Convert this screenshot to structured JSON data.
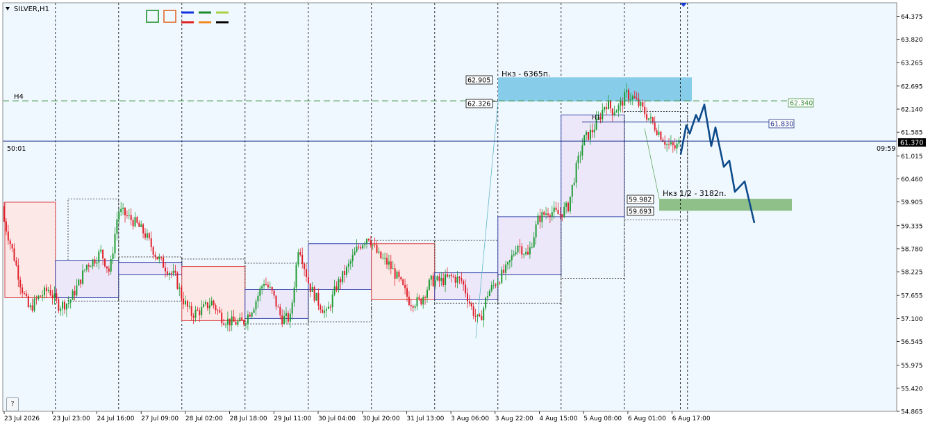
{
  "window": {
    "symbol_title": "SILVER,H1",
    "menu_arrow": "triangle-down-icon",
    "help_label": "?"
  },
  "colors": {
    "background": "#f0f8ff",
    "frame": "#8a8a8a",
    "grid_vertical": "#000000",
    "bull_candle": "#1e9b32",
    "bear_candle": "#e0202a",
    "forecast_line": "#0d4a8a",
    "bid_line": "#1c2f8a",
    "resistance_zone": "#87cdea",
    "support_zone": "#8fc08a",
    "h4_level": "#3d8f3d",
    "red_box_fill": "#fde8e8",
    "red_box_border": "#d93030",
    "blue_box_fill": "#ece8fa",
    "blue_box_border": "#2030a0"
  },
  "toolbar_swatches": [
    {
      "name": "green-square-icon",
      "color": "#1f8f2f"
    },
    {
      "name": "orange-square-icon",
      "color": "#e06a2a"
    },
    {
      "name": "blue-line-icon",
      "color": "#1030e0"
    },
    {
      "name": "green-line-icon",
      "color": "#1a8a2a"
    },
    {
      "name": "lime-line-icon",
      "color": "#a8d040"
    },
    {
      "name": "red-line-icon",
      "color": "#e02020"
    },
    {
      "name": "orange-line-icon",
      "color": "#f08a20"
    },
    {
      "name": "black-line-icon",
      "color": "#000000"
    }
  ],
  "labels": {
    "h4": "H4",
    "h1": "H1",
    "resistance_note": "Нкз - 6365п.",
    "support_note": "Нкз 1/2 - 3182п.",
    "left_timer": "50:01",
    "right_timer": "09:59",
    "resistance_top": "62.905",
    "resistance_bottom": "62.326",
    "support_top": "59.982",
    "support_bottom": "59.693",
    "h4_price": "62.340",
    "line_price": "61.830",
    "current_price": "61.370"
  },
  "chart_data": {
    "type": "candlestick",
    "symbol": "SILVER",
    "timeframe": "H1",
    "ylim": [
      54.865,
      64.7
    ],
    "y_ticks": [
      "64.375",
      "63.820",
      "63.265",
      "62.695",
      "62.140",
      "61.585",
      "61.015",
      "60.460",
      "59.905",
      "59.335",
      "58.780",
      "58.225",
      "57.655",
      "57.100",
      "56.545",
      "55.975",
      "55.420",
      "54.865"
    ],
    "x_ticks": [
      "23 Jul 2026",
      "23 Jul 23:00",
      "24 Jul 16:00",
      "27 Jul 09:00",
      "28 Jul 02:00",
      "28 Jul 18:00",
      "29 Jul 11:00",
      "30 Jul 04:00",
      "30 Jul 20:00",
      "31 Jul 13:00",
      "3 Aug 06:00",
      "3 Aug 22:00",
      "4 Aug 15:00",
      "5 Aug 08:00",
      "6 Aug 01:00",
      "6 Aug 17:00"
    ],
    "price_path": [
      [
        0,
        59.8
      ],
      [
        10,
        59.2
      ],
      [
        20,
        58.6
      ],
      [
        30,
        57.9
      ],
      [
        42,
        57.3
      ],
      [
        55,
        57.6
      ],
      [
        70,
        57.8
      ],
      [
        85,
        57.4
      ],
      [
        100,
        57.5
      ],
      [
        115,
        58.0
      ],
      [
        125,
        58.4
      ],
      [
        135,
        58.5
      ],
      [
        145,
        58.7
      ],
      [
        158,
        58.2
      ],
      [
        170,
        59.7
      ],
      [
        180,
        59.6
      ],
      [
        195,
        59.4
      ],
      [
        210,
        59.1
      ],
      [
        225,
        58.6
      ],
      [
        240,
        58.3
      ],
      [
        252,
        58.1
      ],
      [
        262,
        57.6
      ],
      [
        275,
        57.2
      ],
      [
        290,
        57.3
      ],
      [
        305,
        57.5
      ],
      [
        320,
        57.1
      ],
      [
        335,
        57.0
      ],
      [
        350,
        57.0
      ],
      [
        365,
        57.4
      ],
      [
        380,
        58.0
      ],
      [
        392,
        57.7
      ],
      [
        405,
        57.1
      ],
      [
        418,
        57.1
      ],
      [
        430,
        58.9
      ],
      [
        445,
        57.9
      ],
      [
        458,
        57.5
      ],
      [
        470,
        57.2
      ],
      [
        485,
        57.9
      ],
      [
        500,
        58.3
      ],
      [
        515,
        58.8
      ],
      [
        530,
        59.1
      ],
      [
        545,
        58.6
      ],
      [
        560,
        58.4
      ],
      [
        575,
        58.0
      ],
      [
        590,
        57.5
      ],
      [
        605,
        57.5
      ],
      [
        620,
        58.0
      ],
      [
        635,
        58.0
      ],
      [
        650,
        58.1
      ],
      [
        665,
        58.0
      ],
      [
        680,
        57.3
      ],
      [
        690,
        57.0
      ],
      [
        702,
        57.7
      ],
      [
        715,
        58.0
      ],
      [
        730,
        58.3
      ],
      [
        745,
        58.9
      ],
      [
        760,
        58.6
      ],
      [
        775,
        59.5
      ],
      [
        790,
        59.7
      ],
      [
        805,
        59.6
      ],
      [
        818,
        59.8
      ],
      [
        828,
        60.6
      ],
      [
        840,
        61.4
      ],
      [
        852,
        61.6
      ],
      [
        862,
        61.9
      ],
      [
        872,
        62.3
      ],
      [
        882,
        62.1
      ],
      [
        892,
        62.2
      ],
      [
        902,
        62.5
      ],
      [
        912,
        62.4
      ],
      [
        922,
        62.2
      ],
      [
        935,
        61.9
      ],
      [
        948,
        61.6
      ],
      [
        960,
        61.3
      ],
      [
        972,
        61.2
      ],
      [
        980,
        61.37
      ]
    ],
    "bid_price": 61.37,
    "levels": [
      {
        "name": "H4",
        "price": 62.34
      },
      {
        "name": "H1",
        "price": 61.83
      }
    ],
    "zones": [
      {
        "name": "resistance",
        "from": 62.326,
        "to": 62.905,
        "note": "Нкз - 6365п."
      },
      {
        "name": "support",
        "from": 59.693,
        "to": 59.982,
        "note": "Нкз 1/2 - 3182п."
      }
    ],
    "session_boxes": [
      {
        "i0": 0,
        "i1": 8,
        "lo": 57.6,
        "hi": 59.9,
        "kind": "bear"
      },
      {
        "i0": 8,
        "i1": 18,
        "lo": 57.6,
        "hi": 58.5,
        "kind": "bull"
      },
      {
        "i0": 18,
        "i1": 28,
        "lo": 58.15,
        "hi": 58.45,
        "kind": "bull"
      },
      {
        "i0": 28,
        "i1": 38,
        "lo": 57.05,
        "hi": 58.35,
        "kind": "bear"
      },
      {
        "i0": 38,
        "i1": 48,
        "lo": 57.1,
        "hi": 57.8,
        "kind": "bull"
      },
      {
        "i0": 48,
        "i1": 58,
        "lo": 57.8,
        "hi": 58.9,
        "kind": "bull"
      },
      {
        "i0": 58,
        "i1": 68,
        "lo": 57.55,
        "hi": 58.9,
        "kind": "bear"
      },
      {
        "i0": 68,
        "i1": 78,
        "lo": 57.55,
        "hi": 58.2,
        "kind": "bull"
      },
      {
        "i0": 78,
        "i1": 88,
        "lo": 58.15,
        "hi": 59.55,
        "kind": "bull"
      },
      {
        "i0": 88,
        "i1": 98,
        "lo": 59.55,
        "hi": 62.0,
        "kind": "bull"
      }
    ],
    "forecast": [
      [
        980,
        61.05
      ],
      [
        988,
        61.75
      ],
      [
        993,
        61.55
      ],
      [
        1002,
        62.0
      ],
      [
        1006,
        61.85
      ],
      [
        1014,
        62.25
      ],
      [
        1024,
        61.25
      ],
      [
        1030,
        61.7
      ],
      [
        1042,
        60.75
      ],
      [
        1050,
        60.9
      ],
      [
        1058,
        60.15
      ],
      [
        1072,
        60.4
      ],
      [
        1086,
        59.4
      ]
    ],
    "current_bar_index": 106
  }
}
